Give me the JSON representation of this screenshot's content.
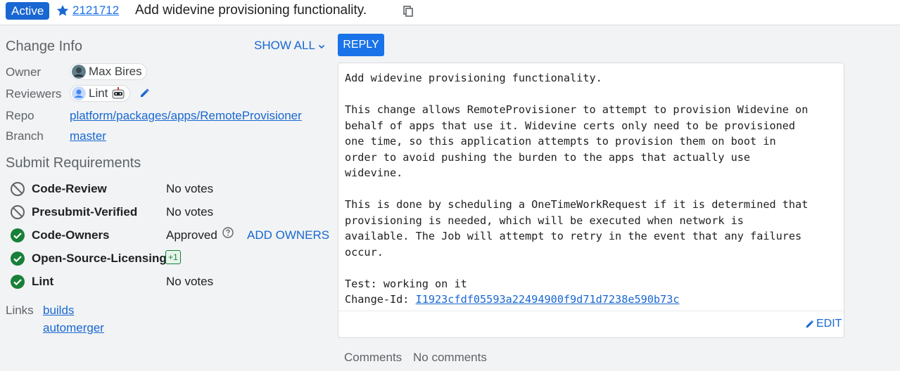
{
  "header": {
    "status": "Active",
    "change_number": "2121712",
    "subject": "Add widevine provisioning functionality."
  },
  "change_info": {
    "title": "Change Info",
    "show_all": "SHOW ALL",
    "owner_label": "Owner",
    "owner_name": "Max Bires",
    "reviewers_label": "Reviewers",
    "reviewer_name": "Lint",
    "repo_label": "Repo",
    "repo_value": "platform/packages/apps/RemoteProvisioner",
    "branch_label": "Branch",
    "branch_value": "master"
  },
  "submit_requirements": {
    "title": "Submit Requirements",
    "items": [
      {
        "name": "Code-Review",
        "status": "No votes",
        "state": "blocked"
      },
      {
        "name": "Presubmit-Verified",
        "status": "No votes",
        "state": "blocked"
      },
      {
        "name": "Code-Owners",
        "status": "Approved",
        "state": "satisfied",
        "action": "ADD OWNERS"
      },
      {
        "name": "Open-Source-Licensing",
        "status": "",
        "vote": "+1",
        "state": "satisfied"
      },
      {
        "name": "Lint",
        "status": "No votes",
        "state": "satisfied"
      }
    ]
  },
  "links": {
    "label": "Links",
    "items": [
      "builds",
      "automerger"
    ]
  },
  "reply_label": "REPLY",
  "commit_message": {
    "body": "Add widevine provisioning functionality.\n\nThis change allows RemoteProvisioner to attempt to provision Widevine on\nbehalf of apps that use it. Widevine certs only need to be provisioned\none time, so this application attempts to provision them on boot in\norder to avoid pushing the burden to the apps that actually use\nwidevine.\n\nThis is done by scheduling a OneTimeWorkRequest if it is determined that\nprovisioning is needed, which will be executed when network is\navailable. The Job will attempt to retry in the event that any failures\noccur.\n\nTest: working on it",
    "change_id_label": "Change-Id: ",
    "change_id": "I1923cfdf05593a22494900f9d71d7238e590b73c",
    "edit_label": "EDIT"
  },
  "comments": {
    "label": "Comments",
    "value": "No comments"
  },
  "colors": {
    "accent": "#1a73e8",
    "link": "#1967d2",
    "satisfied": "#188038",
    "blocked": "#5f6368"
  },
  "icons": {
    "star": "star-icon",
    "copy": "copy-icon",
    "edit": "pencil-icon",
    "satisfied": "check-circle-icon",
    "blocked": "block-icon",
    "help": "help-circle-icon",
    "chevron": "chevron-down-icon"
  }
}
